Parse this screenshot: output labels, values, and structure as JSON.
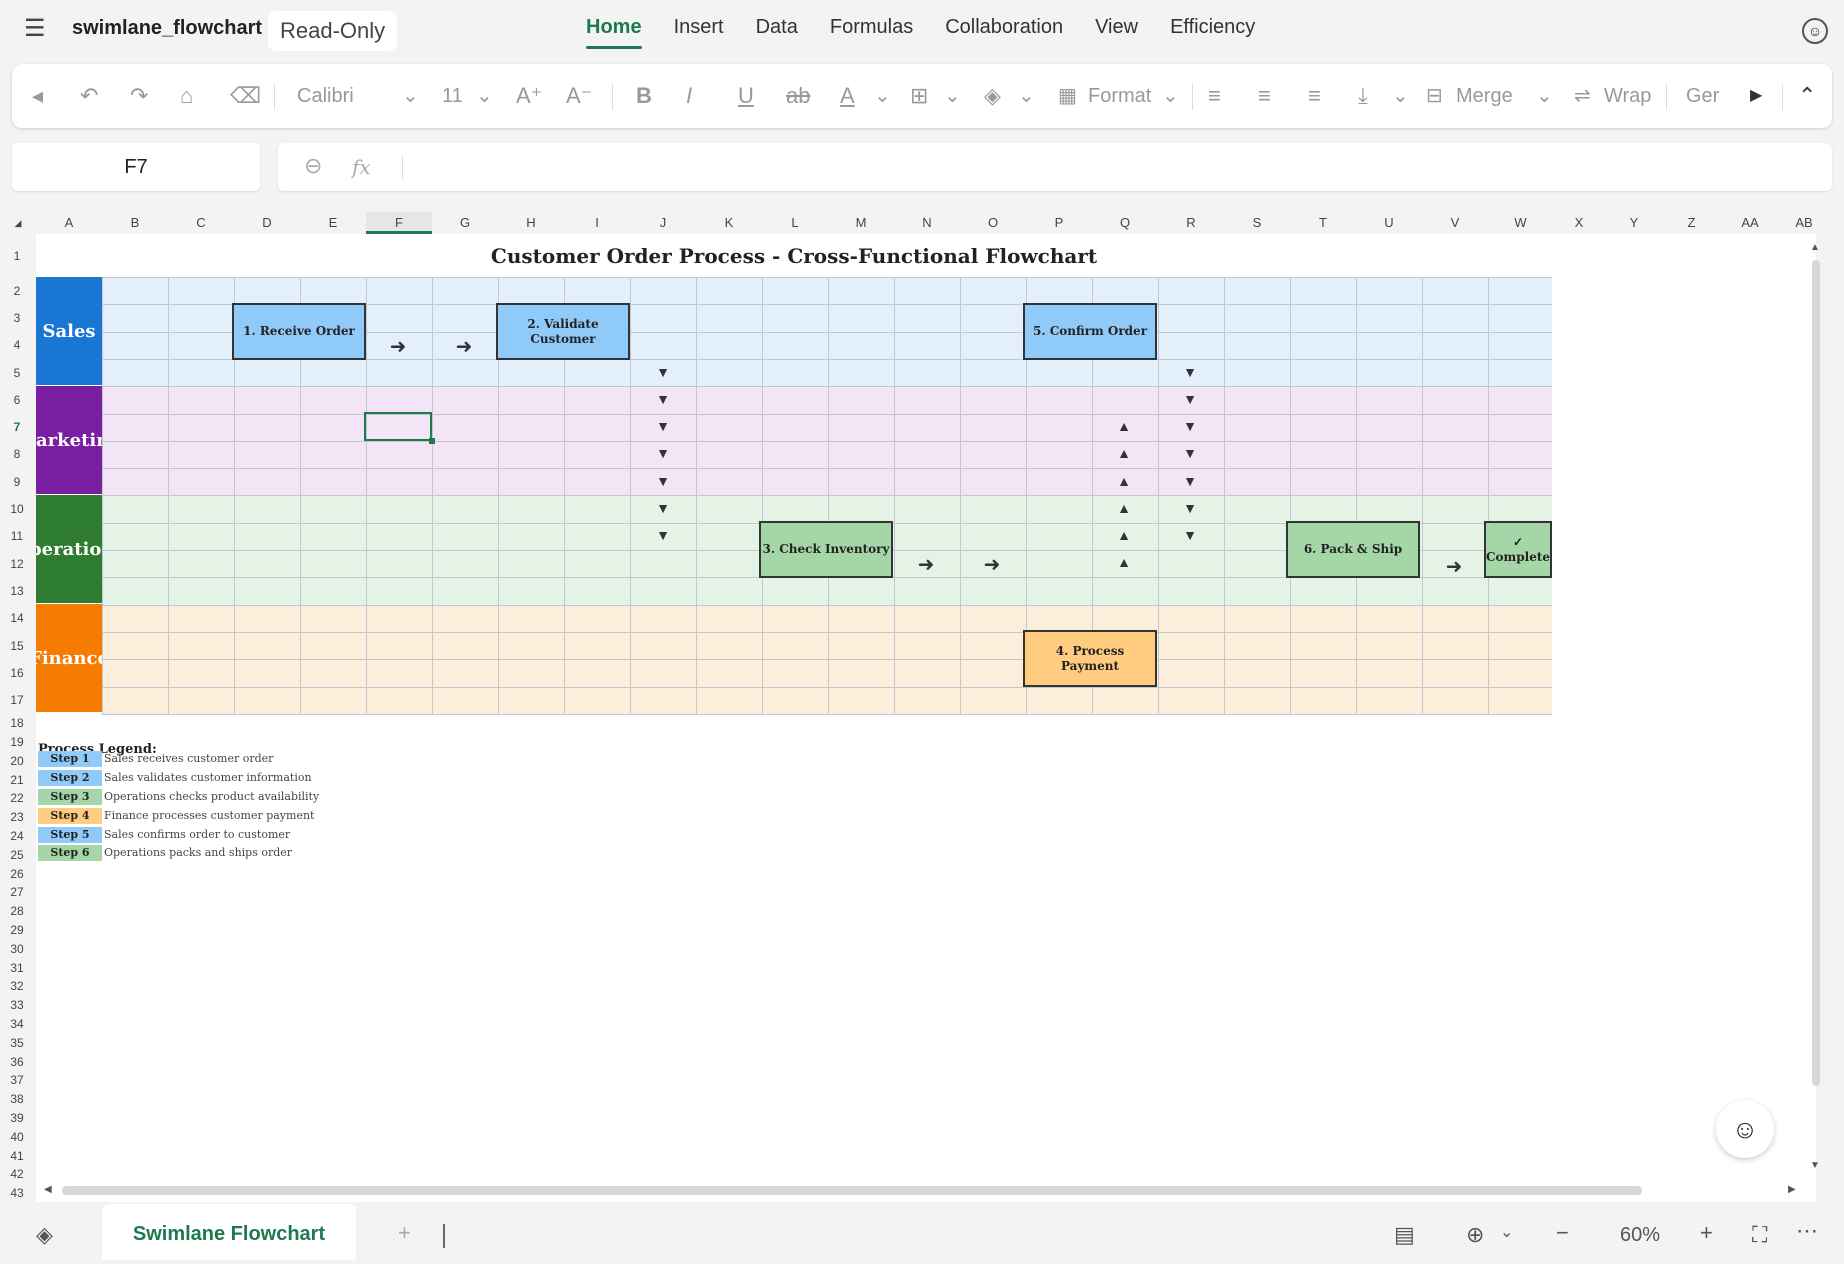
{
  "app": {
    "filename": "swimlane_flowchart",
    "mode_badge": "Read-Only",
    "tabs": [
      "Home",
      "Insert",
      "Data",
      "Formulas",
      "Collaboration",
      "View",
      "Efficiency"
    ],
    "active_tab": "Home"
  },
  "toolbar": {
    "font": "Calibri",
    "font_size": "11",
    "format_label": "Format",
    "merge_label": "Merge",
    "wrap_label": "Wrap",
    "number_format": "Ger"
  },
  "formula": {
    "cell_ref": "F7",
    "fx_label": "fx",
    "value": ""
  },
  "columns": [
    "A",
    "B",
    "C",
    "D",
    "E",
    "F",
    "G",
    "H",
    "I",
    "J",
    "K",
    "L",
    "M",
    "N",
    "O",
    "P",
    "Q",
    "R",
    "S",
    "T",
    "U",
    "V",
    "W",
    "X",
    "Y",
    "Z",
    "AA",
    "AB"
  ],
  "selected_column": "F",
  "selected_row": "7",
  "flowchart": {
    "title": "Customer Order Process - Cross-Functional Flowchart",
    "lanes": [
      {
        "name": "Sales",
        "color": "#1976d2",
        "bg": "#e3f0fc"
      },
      {
        "name": "Marketing",
        "color": "#7b1fa2",
        "bg": "#f3e4f6"
      },
      {
        "name": "Operations",
        "color": "#2e7d32",
        "bg": "#e5f3e6"
      },
      {
        "name": "Finance",
        "color": "#f57c00",
        "bg": "#fdeedb"
      }
    ],
    "steps": {
      "s1": "1. Receive Order",
      "s2": "2. Validate Customer",
      "s3": "3. Check Inventory",
      "s4": "4. Process Payment",
      "s5": "5. Confirm Order",
      "s6": "6. Pack & Ship",
      "complete": "✓ Complete"
    },
    "step_colors": {
      "sales": "#90caf9",
      "operations": "#a5d6a7",
      "finance": "#ffcc80"
    }
  },
  "legend": {
    "title": "Process Legend:",
    "items": [
      {
        "step": "Step 1",
        "desc": "Sales receives customer order",
        "color": "#90caf9"
      },
      {
        "step": "Step 2",
        "desc": "Sales validates customer information",
        "color": "#90caf9"
      },
      {
        "step": "Step 3",
        "desc": "Operations checks product availability",
        "color": "#a5d6a7"
      },
      {
        "step": "Step 4",
        "desc": "Finance processes customer payment",
        "color": "#ffcc80"
      },
      {
        "step": "Step 5",
        "desc": "Sales confirms order to customer",
        "color": "#90caf9"
      },
      {
        "step": "Step 6",
        "desc": "Operations packs and ships order",
        "color": "#a5d6a7"
      }
    ]
  },
  "sheet_tabs": [
    "Swimlane Flowchart"
  ],
  "status": {
    "zoom": "60%"
  },
  "icons": {
    "arrow_right": "➜",
    "tri_down": "▼",
    "tri_up": "▲"
  }
}
